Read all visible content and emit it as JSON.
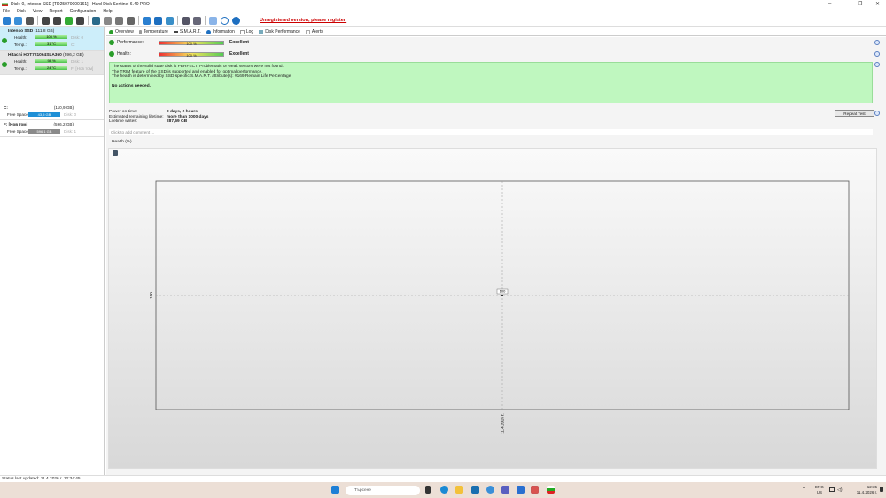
{
  "window": {
    "title": "Disk: 0, Intenso SSD [TD25070000161]  -  Hard Disk Sentinel 6.40 PRO",
    "minimize": "–",
    "maximize": "❐",
    "close": "✕"
  },
  "menu": [
    "File",
    "Disk",
    "View",
    "Report",
    "Configuration",
    "Help"
  ],
  "toolbar": {
    "unregistered": "Unregistered version, please register.",
    "icons": [
      "refresh-icon",
      "refresh-all-icon",
      "disk-list-icon",
      "disk-icon",
      "disk-icon",
      "disk-ok-icon",
      "disk-icon",
      "backup-icon",
      "alert-icon",
      "satellite-icon",
      "printer-icon",
      "report-icon",
      "email-icon",
      "network-icon",
      "gear-icon",
      "gear-icon",
      "clipboard-icon",
      "help-icon",
      "info-icon"
    ]
  },
  "disks": [
    {
      "name": "Intenso SSD",
      "size": "(111,8 GB)",
      "health": "100 %",
      "health_extra": "Disk: 0",
      "temp": "31 °C",
      "temp_extra": "C:"
    },
    {
      "name": "Hitachi HDT721064SLA360",
      "size": "(596,2 GB)",
      "health": "98 %",
      "health_extra": "Disk: 1",
      "temp": "24 °C",
      "temp_extra": "F: [Нов том]"
    }
  ],
  "labels": {
    "health": "Health:",
    "temp": "Temp.:",
    "free_space": "Free Space"
  },
  "volumes": [
    {
      "name": "C:",
      "size": "(110,9 GB)",
      "free": "43,5 GB",
      "disk": "Disk: 0",
      "color": "#1e8fd6"
    },
    {
      "name": "F: [Нов том]",
      "size": "(596,2 GB)",
      "free": "596,1 GB",
      "disk": "Disk: 1",
      "color": "#8a8a8a"
    }
  ],
  "tabs": [
    "Overview",
    "Temperature",
    "S.M.A.R.T.",
    "Information",
    "Log",
    "Disk Performance",
    "Alerts"
  ],
  "overview": {
    "performance_label": "Performance:",
    "performance_value": "100 %",
    "performance_rating": "Excellent",
    "health_label": "Health:",
    "health_value": "100 %",
    "health_rating": "Excellent",
    "messages": [
      "The status of the solid state disk is PERFECT. Problematic or weak sectors were not found.",
      "The TRIM feature of the SSD is supported and enabled for optimal performance.",
      "The health is determined by SSD specific S.M.A.R.T. attribute(s):  #169 Remain Life Percentage"
    ],
    "no_actions": "No actions needed.",
    "info": [
      {
        "label": "Power on time:",
        "value": "2 days, 2 hours"
      },
      {
        "label": "Estimated remaining lifetime:",
        "value": "more than 1000 days"
      },
      {
        "label": "Lifetime writes:",
        "value": "287,69 GB"
      }
    ],
    "repeat_test": "Repeat Test",
    "comment_placeholder": "Click to add comment ..."
  },
  "chart_data": {
    "type": "line",
    "title": "Health (%)",
    "x": [
      "11.4.2026 г."
    ],
    "values": [
      100
    ],
    "ytick": "100",
    "data_label": "100",
    "grid": true
  },
  "statusbar": "Status last updated: 11.4.2026 г. 12:34:45",
  "taskbar": {
    "search": "Търсене",
    "lang": "ENG",
    "region": "US",
    "time": "12:35",
    "date": "11.4.2026 г."
  }
}
